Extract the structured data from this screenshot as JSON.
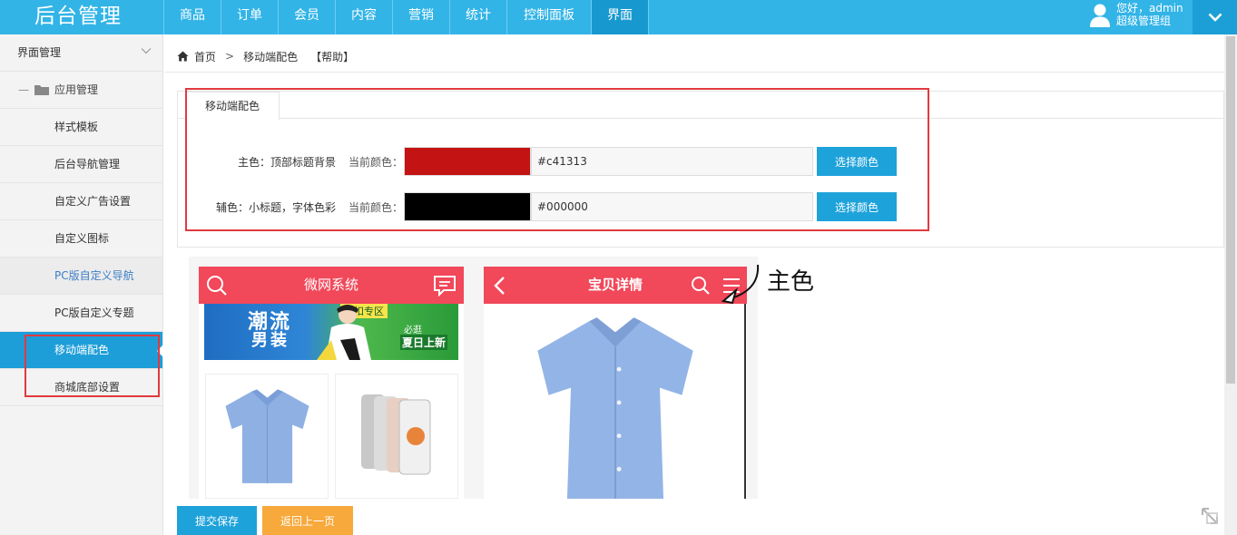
{
  "app": {
    "logo": "后台管理"
  },
  "nav": {
    "items": [
      {
        "label": "商品"
      },
      {
        "label": "订单"
      },
      {
        "label": "会员"
      },
      {
        "label": "内容"
      },
      {
        "label": "营销"
      },
      {
        "label": "统计"
      },
      {
        "label": "控制面板"
      },
      {
        "label": "界面"
      }
    ],
    "active": "界面"
  },
  "user": {
    "greeting": "您好，admin",
    "role": "超级管理组"
  },
  "sidebar": {
    "header": "界面管理",
    "group": "应用管理",
    "group_prefix": "—",
    "items": [
      {
        "label": "样式模板"
      },
      {
        "label": "后台导航管理"
      },
      {
        "label": "自定义广告设置"
      },
      {
        "label": "自定义图标"
      },
      {
        "label": "PC版自定义导航"
      },
      {
        "label": "PC版自定义专题"
      },
      {
        "label": "移动端配色"
      },
      {
        "label": "商城底部设置"
      }
    ],
    "active": "移动端配色"
  },
  "breadcrumb": {
    "home": "首页",
    "separator": ">",
    "current": "移动端配色",
    "help": "【帮助】"
  },
  "panel": {
    "tab": "移动端配色",
    "rows": [
      {
        "label": "主色：顶部标题背景",
        "current_label": "当前颜色：",
        "color": "#c41313",
        "value": "#c41313",
        "button": "选择颜色"
      },
      {
        "label": "辅色：小标题，字体色彩",
        "current_label": "当前颜色：",
        "color": "#000000",
        "value": "#000000",
        "button": "选择颜色"
      }
    ]
  },
  "preview": {
    "phone1": {
      "title": "微网系统",
      "banner_big": "潮流",
      "banner_second": "男装",
      "banner_tag": "夏日上新",
      "banner_top": "折扣专区",
      "banner_small": "必逛"
    },
    "phone2": {
      "title": "宝贝详情"
    },
    "annotation": "主色",
    "bar_color": "#f1485a"
  },
  "actions": {
    "save": "提交保存",
    "back": "返回上一页"
  }
}
